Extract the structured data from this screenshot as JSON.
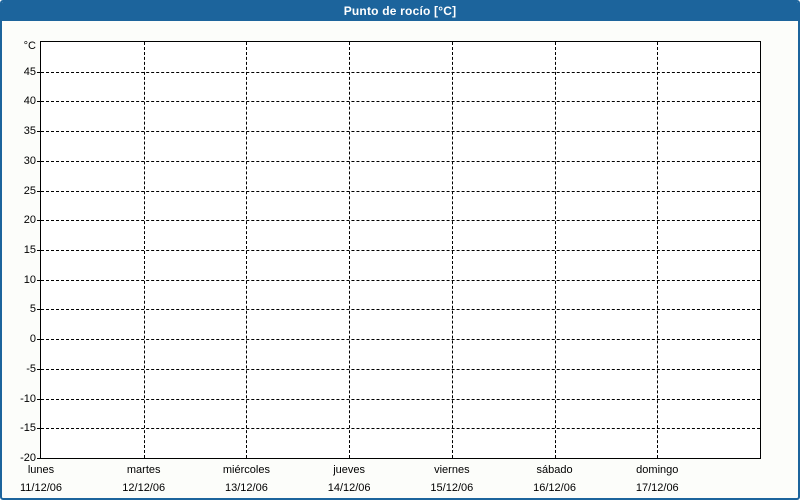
{
  "window": {
    "title": "Punto de rocío [°C]"
  },
  "colors": {
    "frame": "#1c649c",
    "title_text": "#ffffff",
    "content_bg": "#fcfdfa",
    "plot_bg": "#ffffff",
    "plot_border": "#000000",
    "grid": "#000000",
    "label_text": "#000000"
  },
  "chart_data": {
    "type": "line",
    "title": "Punto de rocío [°C]",
    "xlabel": "",
    "ylabel": "°C",
    "ylim": [
      -20,
      50
    ],
    "ytick_interval": 5,
    "yticks": [
      45,
      40,
      35,
      30,
      25,
      20,
      15,
      10,
      5,
      0,
      -5,
      -10,
      -15,
      -20
    ],
    "categories": [
      {
        "day": "lunes",
        "date": "11/12/06"
      },
      {
        "day": "martes",
        "date": "12/12/06"
      },
      {
        "day": "miércoles",
        "date": "13/12/06"
      },
      {
        "day": "jueves",
        "date": "14/12/06"
      },
      {
        "day": "viernes",
        "date": "15/12/06"
      },
      {
        "day": "sábado",
        "date": "16/12/06"
      },
      {
        "day": "domingo",
        "date": "17/12/06"
      }
    ],
    "series": [],
    "grid": {
      "style": "dashed",
      "horizontal": true,
      "vertical": true
    },
    "legend": "none"
  }
}
